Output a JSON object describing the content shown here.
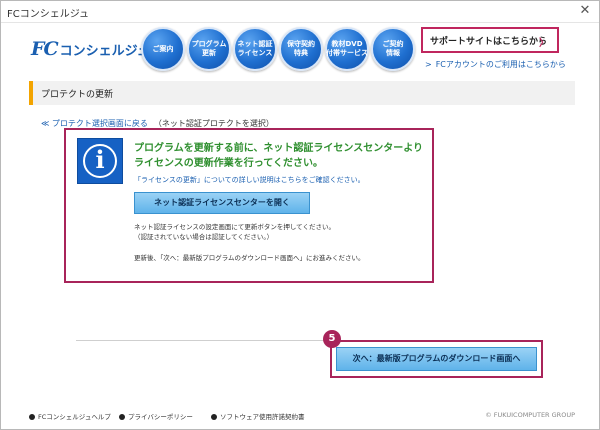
{
  "window": {
    "title": "FCコンシェルジュ",
    "close_glyph": "✕"
  },
  "logo": {
    "mark": "FC",
    "name": "コンシェルジュ"
  },
  "nav": [
    {
      "label": "ご案内"
    },
    {
      "label": "プログラム\n更新"
    },
    {
      "label": "ネット認証\nライセンス"
    },
    {
      "label": "保守契約\n特典"
    },
    {
      "label": "教材DVD\n付帯サービス"
    },
    {
      "label": "ご契約\n情報"
    }
  ],
  "support": {
    "label": "サポートサイトはこちらから",
    "chevron": "〉"
  },
  "account": {
    "chevron": ">",
    "label": "FCアカウントのご利用はこちらから"
  },
  "section": {
    "title": "プロテクトの更新"
  },
  "breadcrumb": {
    "back": "≪ プロテクト選択画面に戻る",
    "note": "（ネット認証プロテクトを選択）"
  },
  "info": {
    "icon_glyph": "i",
    "headline": "プログラムを更新する前に、ネット認証ライセンスセンターより ライセンスの更新作業を行ってください。",
    "detail_link": "「ライセンスの更新」についての詳しい説明はこちらをご確認ください。",
    "open_button": "ネット認証ライセンスセンターを開く",
    "desc_line1": "ネット認証ライセンスの設定画面にて更新ボタンを押してください。",
    "desc_line2": "（認証されていない場合は認証してください。）",
    "desc_after": "更新後、「次へ：最新版プログラムのダウンロード画面へ」にお進みください。"
  },
  "step": {
    "number": "5"
  },
  "next_button": "次へ：最新版プログラムのダウンロード画面へ",
  "footer": {
    "help": "FCコンシェルジュヘルプ",
    "privacy": "プライバシーポリシー",
    "license": "ソフトウェア使用許諾契約書",
    "copyright": "© FUKUICOMPUTER GROUP"
  }
}
